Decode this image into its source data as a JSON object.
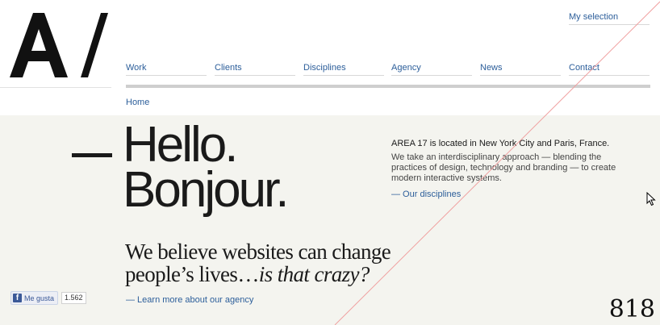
{
  "header": {
    "logo_text": "A/",
    "my_selection": "My selection",
    "nav": [
      "Work",
      "Clients",
      "Disciplines",
      "Agency",
      "News",
      "Contact"
    ],
    "breadcrumb": "Home"
  },
  "hero": {
    "line1": "Hello.",
    "line2": "Bonjour.",
    "belief_main": "We believe websites can change people’s lives…",
    "belief_em": "is that crazy?",
    "learn_more": "— Learn more about our agency"
  },
  "about": {
    "title": "AREA 17 is located in New York City and Paris, France.",
    "body": "We take an interdisciplinary approach — blending the practices of design, technology and branding — to create modern interactive systems.",
    "link": "— Our disciplines"
  },
  "facebook": {
    "icon": "f",
    "label": "Me gusta",
    "count": "1.562"
  },
  "overlay_number": "818",
  "colors": {
    "link": "#2c5e9a",
    "main_bg": "#f4f4ef",
    "diagonal": "#f0a0a0"
  }
}
